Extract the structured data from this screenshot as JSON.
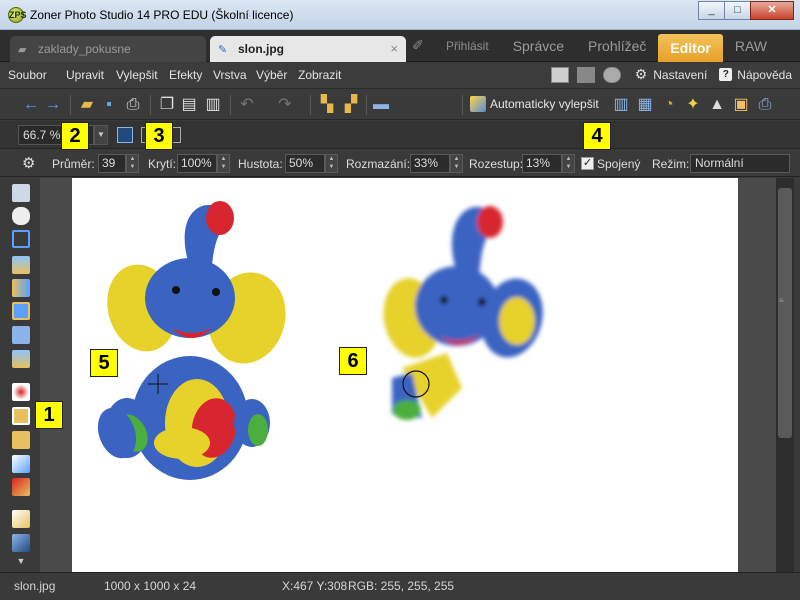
{
  "window": {
    "title": "Zoner Photo Studio 14 PRO EDU (Školní licence)",
    "app_icon": "ZPS"
  },
  "tabs": {
    "doc_inactive": "zaklady_pokusne",
    "doc_active": "slon.jpg",
    "close_glyph": "×",
    "login": "Přihlásit",
    "modules": [
      "Správce",
      "Prohlížeč",
      "Editor",
      "RAW"
    ],
    "active_module": "Editor"
  },
  "menu": {
    "items": [
      "Soubor",
      "Upravit",
      "Vylepšit",
      "Efekty",
      "Vrstva",
      "Výběr",
      "Zobrazit"
    ],
    "settings": "Nastavení",
    "help": "Nápověda"
  },
  "toolbar": {
    "auto_enhance": "Automaticky vylepšit"
  },
  "zoom": {
    "value": "66.7 %"
  },
  "props": {
    "diameter_label": "Průměr:",
    "diameter_value": "39",
    "coverage_label": "Krytí:",
    "coverage_value": "100%",
    "density_label": "Hustota:",
    "density_value": "50%",
    "blur_label": "Rozmazání:",
    "blur_value": "33%",
    "spacing_label": "Rozestup:",
    "spacing_value": "13%",
    "connected_label": "Spojený",
    "connected_checked": true,
    "mode_label": "Režim:",
    "mode_value": "Normální"
  },
  "status": {
    "filename": "slon.jpg",
    "dimensions": "1000 x 1000 x 24",
    "coords": "X:467 Y:308",
    "rgb": "RGB: 255, 255, 255"
  },
  "callouts": [
    "1",
    "2",
    "3",
    "4",
    "5",
    "6"
  ],
  "colors": {
    "accent": "#e7a02a",
    "callout": "#ffff00",
    "elephant_blue": "#3b64c2",
    "elephant_yellow": "#e6d22b",
    "trunk_red": "#d7262f",
    "foot_green": "#4cae3e"
  }
}
